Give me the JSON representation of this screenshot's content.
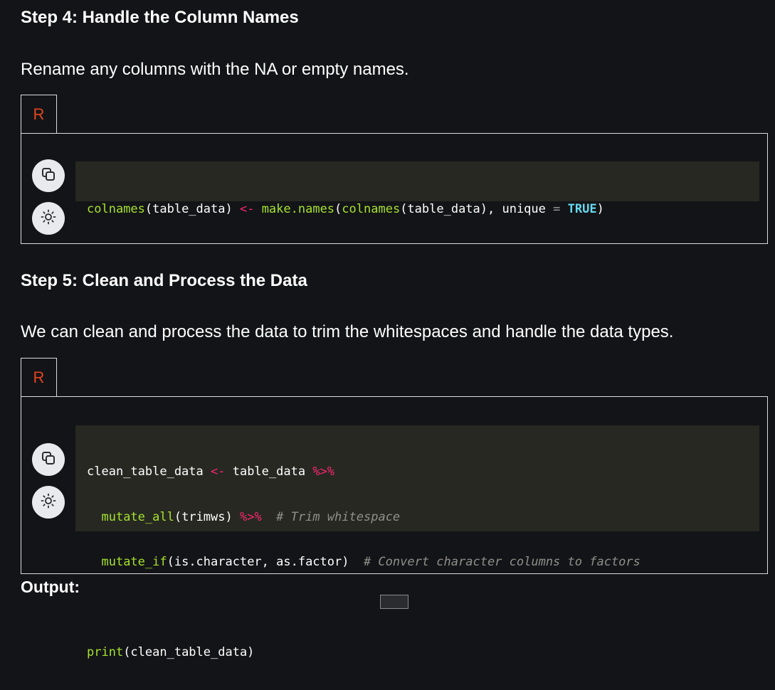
{
  "step4": {
    "heading": "Step 4: Handle the Column Names",
    "description": "Rename any columns with the NA or empty names.",
    "language": "R",
    "code": {
      "line1": {
        "fn1": "colnames",
        "t1": "(table_data) ",
        "op1": "<-",
        "sp1": " ",
        "fn2": "make.names",
        "t2": "(",
        "fn3": "colnames",
        "t3": "(table_data), unique ",
        "eq": "=",
        "sp2": " ",
        "bool": "TRUE",
        "t4": ")"
      }
    }
  },
  "step5": {
    "heading": "Step 5: Clean and Process the Data",
    "description": "We can clean and process the data to trim the whitespaces and handle the data types.",
    "language": "R",
    "code": {
      "line1": {
        "t1": "clean_table_data ",
        "op1": "<-",
        "t2": " table_data ",
        "op2": "%>%"
      },
      "line2": {
        "indent": "  ",
        "fn1": "mutate_all",
        "t1": "(trimws) ",
        "op1": "%>%",
        "sp": "  ",
        "cm": "# Trim whitespace"
      },
      "line3": {
        "indent": "  ",
        "fn1": "mutate_if",
        "t1": "(is.character, as.factor)  ",
        "cm": "# Convert character columns to factors"
      },
      "line5": {
        "fn1": "print",
        "t1": "(clean_table_data)"
      }
    }
  },
  "output_label": "Output:",
  "icons": {
    "copy": "copy-icon",
    "theme": "sun-icon"
  },
  "colors": {
    "background": "#131417",
    "code_background": "#272822",
    "language_tab": "#e2461f",
    "function": "#a6e22e",
    "operator": "#f92672",
    "boolean": "#66d9ef",
    "comment": "#8f908a"
  }
}
